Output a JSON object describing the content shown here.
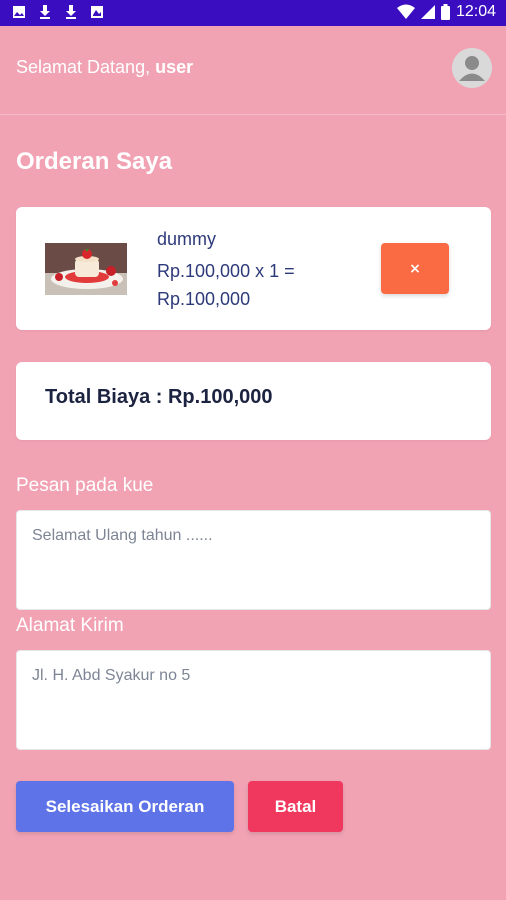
{
  "status_bar": {
    "time": "12:04",
    "icons": [
      "image-icon",
      "download-icon",
      "download-icon",
      "photo-icon",
      "wifi-icon",
      "signal-icon",
      "battery-icon"
    ],
    "background": "#3a0ec0"
  },
  "header": {
    "welcome_prefix": "Selamat Datang,",
    "username": "user"
  },
  "page": {
    "title": "Orderan Saya"
  },
  "order": {
    "item_name": "dummy",
    "price_line": "Rp.100,000 x 1 =",
    "subtotal": "Rp.100,000",
    "remove_label": "×"
  },
  "total": {
    "label": "Total Biaya : Rp.100,000"
  },
  "form": {
    "message_label": "Pesan pada kue",
    "message_placeholder": "Selamat Ulang tahun ......",
    "address_label": "Alamat Kirim",
    "address_placeholder": "Jl. H. Abd Syakur no 5"
  },
  "actions": {
    "finish_label": "Selesaikan Orderan",
    "cancel_label": "Batal"
  },
  "colors": {
    "background": "#f1a3b4",
    "finish_button": "#5f73e9",
    "cancel_button": "#f0375e",
    "remove_button": "#fa6a43"
  }
}
